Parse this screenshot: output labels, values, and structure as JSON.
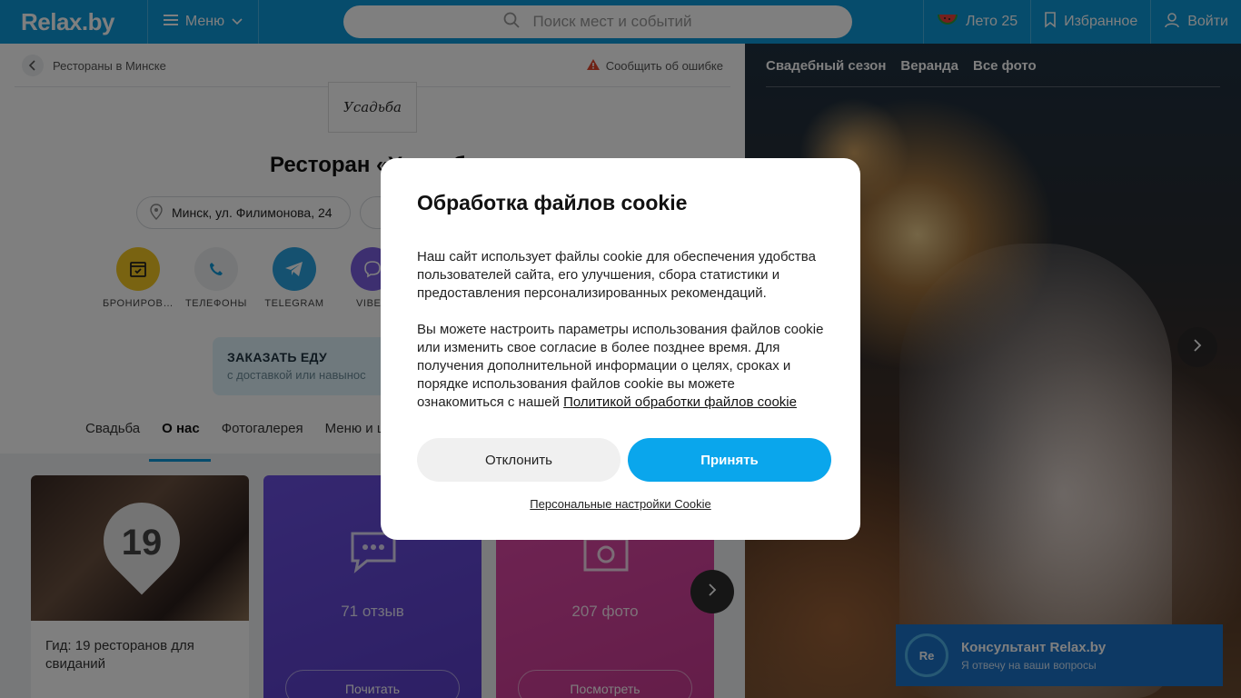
{
  "header": {
    "logo": "Relax.by",
    "menu_label": "Меню",
    "search_placeholder": "Поиск мест и событий",
    "summer_label": "Лето 25",
    "favorites_label": "Избранное",
    "login_label": "Войти"
  },
  "breadcrumb": {
    "back_label": "Рестораны в Минске",
    "report_label": "Сообщить об ошибке"
  },
  "venue": {
    "logo_text": "Усадьба",
    "title": "Ресторан «Усадьба»",
    "address": "Минск, ул. Филимонова, 24",
    "actions": [
      "БРОНИРОВ…",
      "ТЕЛЕФОНЫ",
      "TELEGRAM",
      "VIBER"
    ],
    "order_food_title": "ЗАКАЗАТЬ ЕДУ",
    "order_food_sub": "с доставкой или навынос",
    "tabs": [
      "Свадьба",
      "О нас",
      "Фотогалерея",
      "Меню и цены"
    ]
  },
  "cards": {
    "guide_number": "19",
    "guide_text": "Гид: 19 ресторанов для свиданий",
    "reviews_count": "71 отзыв",
    "reviews_button": "Почитать",
    "photos_count": "207 фото",
    "photos_button": "Посмотреть"
  },
  "photo_panel": {
    "tabs": [
      "Свадебный сезон",
      "Веранда",
      "Все фото"
    ]
  },
  "consultant": {
    "avatar": "Re",
    "title": "Консультант Relax.by",
    "subtitle": "Я отвечу на ваши вопросы"
  },
  "cookie_modal": {
    "title": "Обработка файлов cookie",
    "paragraph1": "Наш сайт использует файлы cookie для обеспечения удобства пользователей сайта, его улучшения, сбора статистики и предоставления персонализированных рекомендаций.",
    "paragraph2": "Вы можете настроить параметры использования файлов cookie или изменить свое согласие в более позднее время. Для получения дополнительной информации о целях, сроках и порядке использования файлов cookie вы можете ознакомиться с нашей",
    "policy_link": "Политикой обработки файлов cookie",
    "decline_label": "Отклонить",
    "accept_label": "Принять",
    "settings_label": "Персональные настройки Cookie"
  },
  "colors": {
    "brand": "#0d98d8",
    "accept": "#0aa6ec",
    "booking": "#f3c623",
    "telegram": "#2aa3e0",
    "viber": "#7b5ee0"
  }
}
